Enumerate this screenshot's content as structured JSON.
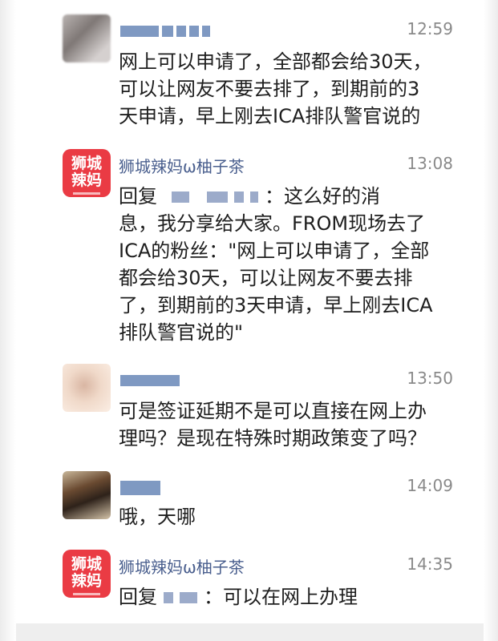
{
  "messages": [
    {
      "sender": "",
      "time": "12:59",
      "text": "网上可以申请了，全部都会给30天，\n可以让网友不要去排了，到期前的3\n天申请，早上刚去ICA排队警官说的"
    },
    {
      "sender": "狮城辣妈ω柚子茶",
      "time": "13:08",
      "reply_prefix": "回复",
      "reply_suffix": "：这么好的消",
      "text": "息，我分享给大家。FROM现场去了\nICA的粉丝：\"网上可以申请了，全部\n都会给30天，可以让网友不要去排\n了，到期前的3天申请，早上刚去ICA\n排队警官说的\""
    },
    {
      "sender": "",
      "time": "13:50",
      "text": "可是签证延期不是可以直接在网上办\n理吗？是现在特殊时期政策变了吗？"
    },
    {
      "sender": "",
      "time": "14:09",
      "text": "哦，天哪"
    },
    {
      "sender": "狮城辣妈ω柚子茶",
      "time": "14:35",
      "reply_prefix": "回复",
      "reply_suffix": "：可以在网上办理"
    }
  ],
  "brand_avatar": {
    "line1": "狮城",
    "line2": "辣妈"
  },
  "colors": {
    "name": "#4a5f8e",
    "time": "#8a8a8a",
    "brand": "#ea3b44"
  }
}
